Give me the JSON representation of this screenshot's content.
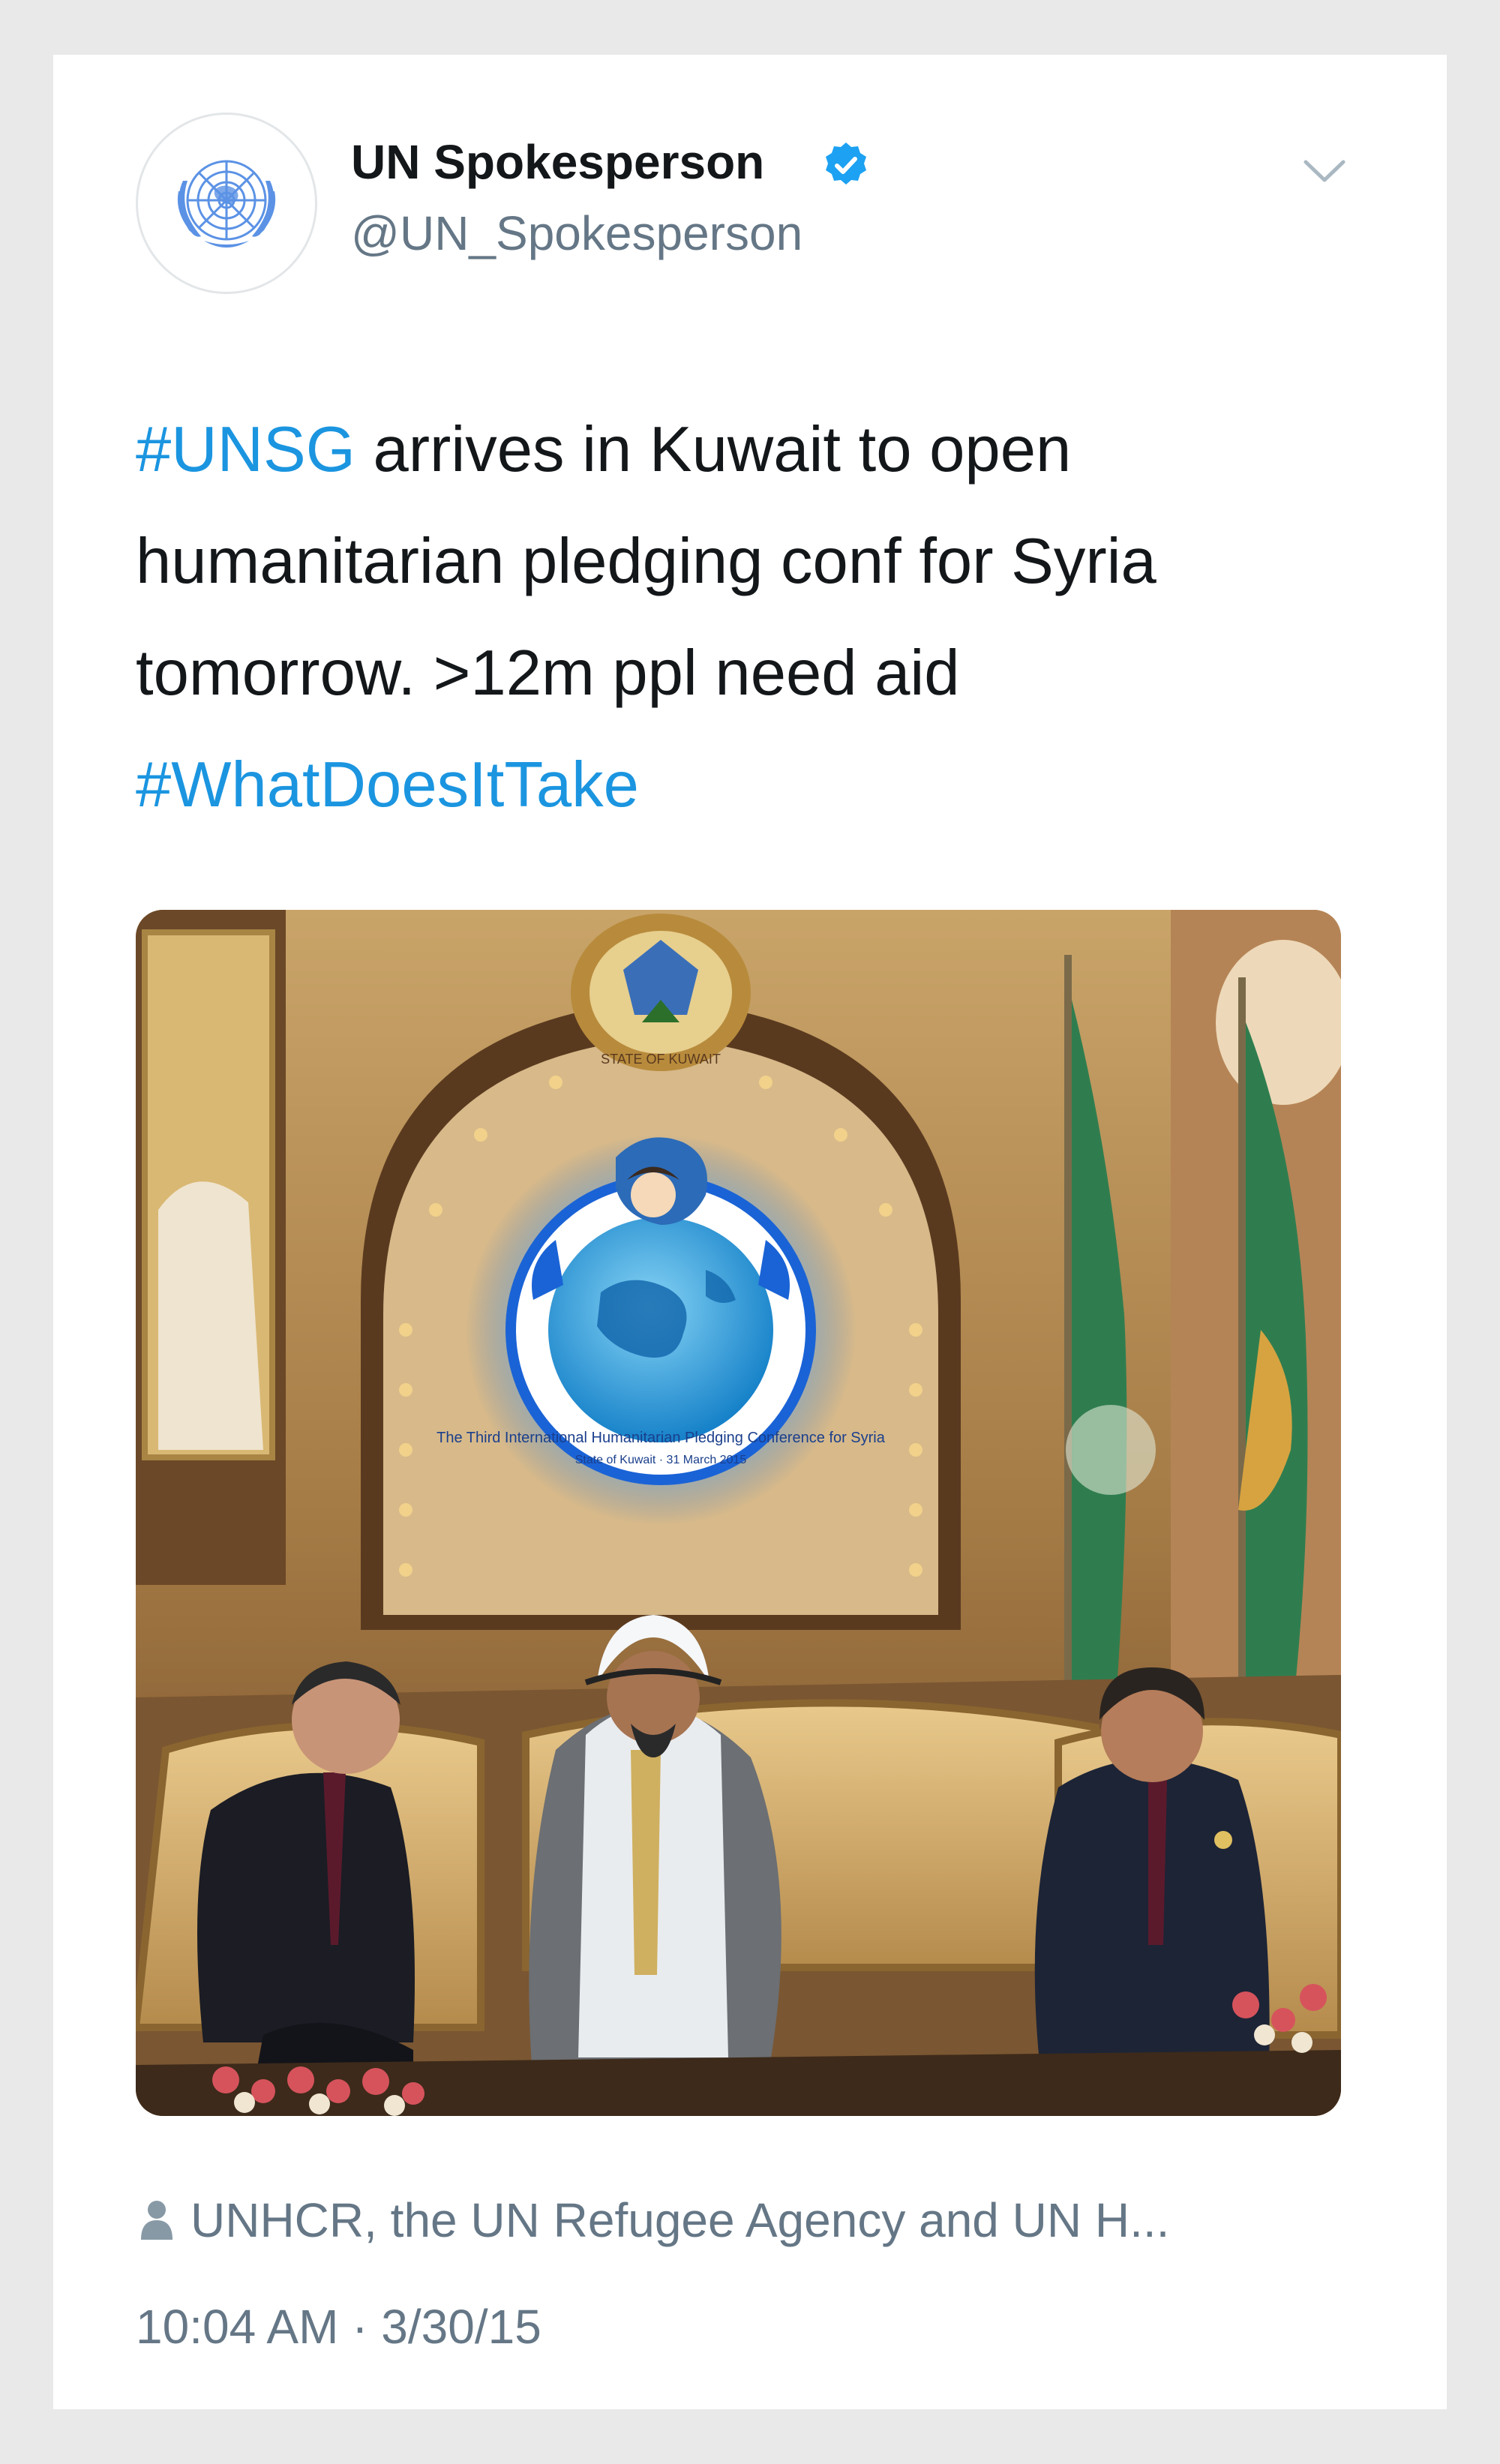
{
  "tweet": {
    "author": {
      "display_name": "UN Spokesperson",
      "handle": "@UN_Spokesperson",
      "verified": true
    },
    "text": {
      "hashtag_1": "#UNSG",
      "body": " arrives in Kuwait to open humanitarian pledging conf for Syria tomorrow. >12m ppl need aid ",
      "hashtag_2": "#WhatDoesItTake"
    },
    "photo": {
      "sign_emblem_text": "STATE OF KUWAIT",
      "conference_logo_text": "The Third International Humanitarian Pledging Conference for Syria",
      "conference_logo_subtext": "State of Kuwait · 31 March 2015"
    },
    "tagged_people": "UNHCR, the UN Refugee Agency and UN H...",
    "timestamp": "10:04 AM · 3/30/15"
  },
  "colors": {
    "hashtag": "#1b95e0",
    "verified_badge": "#1da1f2",
    "secondary_text": "#657786",
    "primary_text": "#14171a",
    "background": "#e9e9ea",
    "un_blue": "#5b92e5"
  },
  "icons": {
    "verified": "verified-badge-icon",
    "caret": "chevron-down-icon",
    "tagged": "person-icon"
  }
}
